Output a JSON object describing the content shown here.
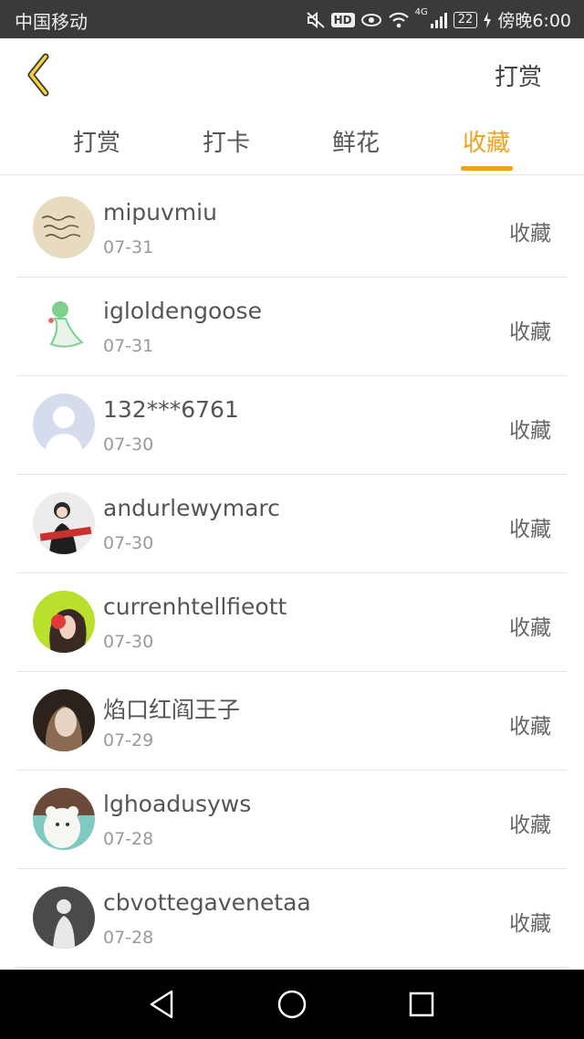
{
  "status": {
    "carrier": "中国移动",
    "hd": "HD",
    "network": "4G",
    "battery": "22",
    "time": "傍晚6:00"
  },
  "header": {
    "action_label": "打赏"
  },
  "tabs": [
    {
      "label": "打赏",
      "active": false
    },
    {
      "label": "打卡",
      "active": false
    },
    {
      "label": "鲜花",
      "active": false
    },
    {
      "label": "收藏",
      "active": true
    }
  ],
  "list": [
    {
      "name": "mipuvmiu",
      "date": "07-31",
      "action": "收藏"
    },
    {
      "name": "igloldengoose",
      "date": "07-31",
      "action": "收藏"
    },
    {
      "name": "132***6761",
      "date": "07-30",
      "action": "收藏"
    },
    {
      "name": "andurlewymarc",
      "date": "07-30",
      "action": "收藏"
    },
    {
      "name": "currenhtellfieott",
      "date": "07-30",
      "action": "收藏"
    },
    {
      "name": "焰口红阎王子",
      "date": "07-29",
      "action": "收藏"
    },
    {
      "name": "lghoadusyws",
      "date": "07-28",
      "action": "收藏"
    },
    {
      "name": "cbvottegavenetaa",
      "date": "07-28",
      "action": "收藏"
    }
  ],
  "colors": {
    "accent": "#f0a21e",
    "status_bar": "#3a3a3a",
    "nav_bar": "#000000"
  },
  "icons": [
    "back-icon",
    "mute-icon",
    "eye-icon",
    "wifi-icon",
    "signal-icon",
    "charging-icon",
    "nav-back-icon",
    "nav-home-icon",
    "nav-recents-icon"
  ]
}
